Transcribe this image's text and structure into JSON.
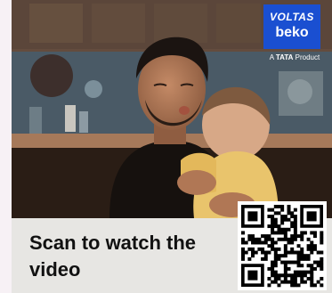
{
  "promo": {
    "brand": {
      "line1": "VOLTAS",
      "line2": "beko",
      "tag_prefix": "A ",
      "tag_brand": "TATA",
      "tag_suffix": " Product"
    },
    "caption": "Scan to watch the video",
    "qr_icon": "qr-code-icon",
    "colors": {
      "brand_blue": "#1a4fd1",
      "caption_panel": "#e7e6e3"
    }
  }
}
